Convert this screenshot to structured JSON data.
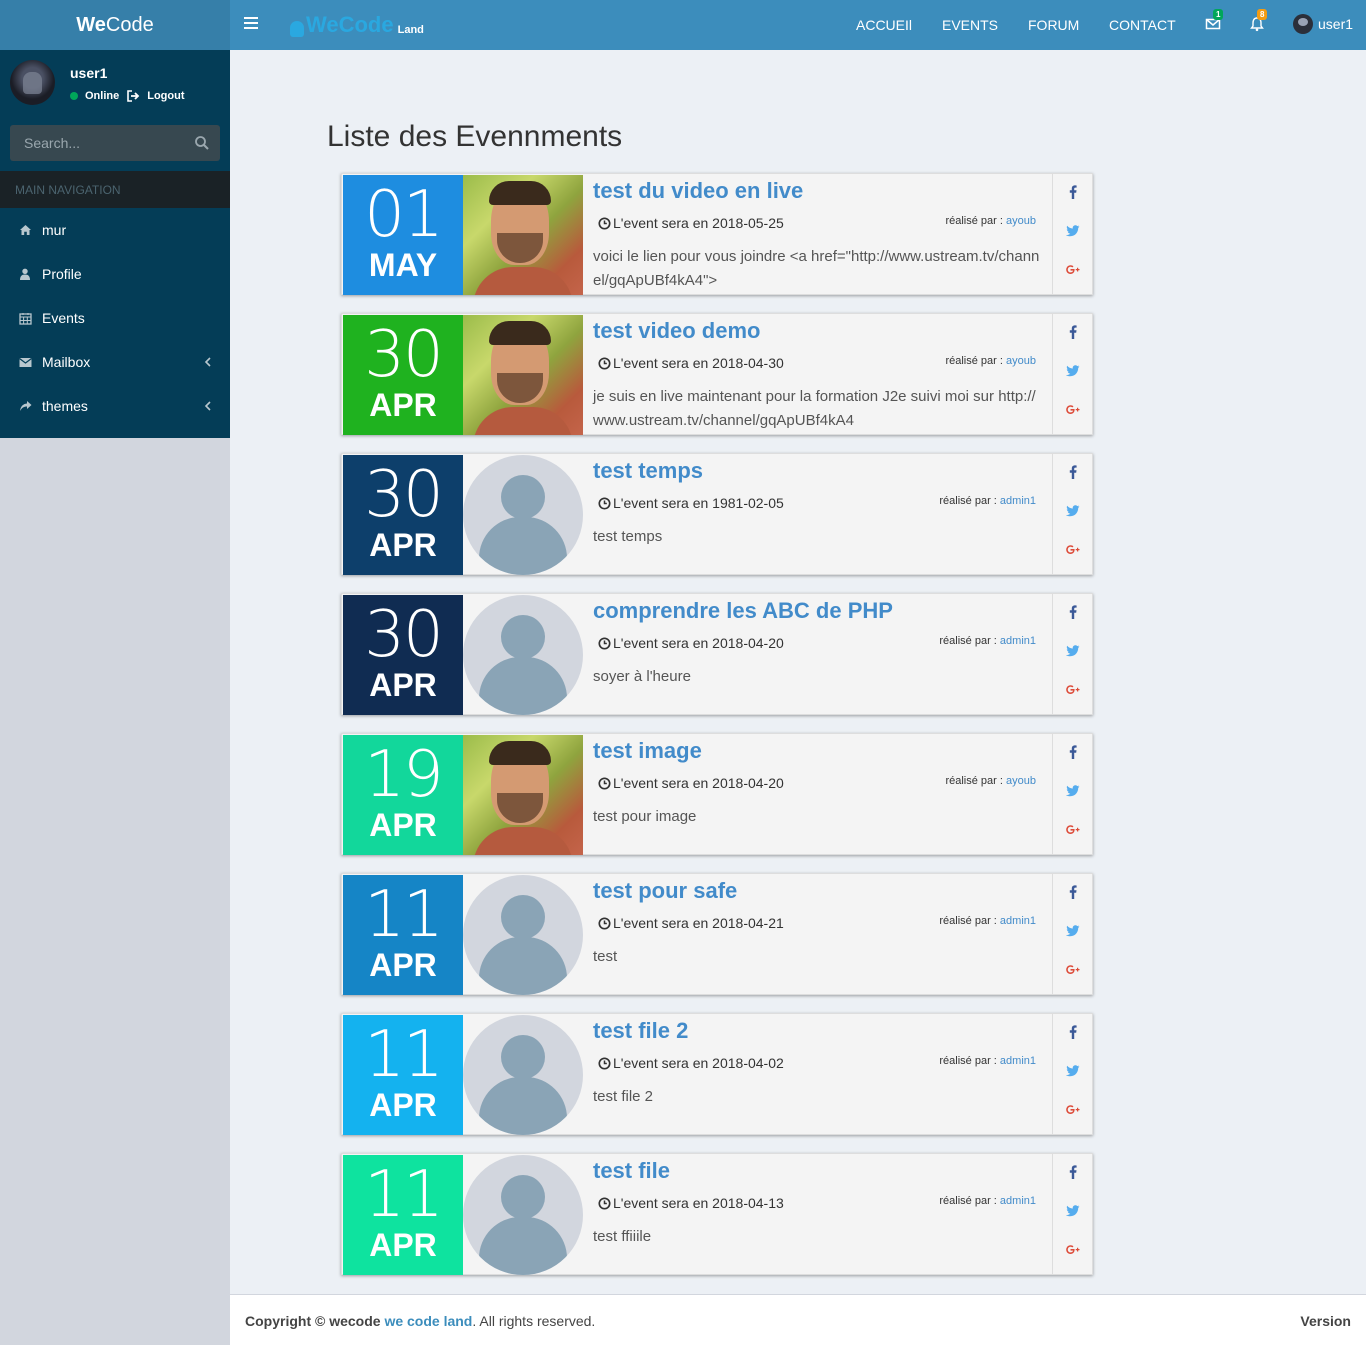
{
  "app": {
    "logo_bold": "We",
    "logo_rest": "Code"
  },
  "header": {
    "brand_name": "WeCode",
    "brand_sub": "Land",
    "nav": [
      "ACCUEIl",
      "EVENTS",
      "FORUM",
      "CONTACT"
    ],
    "messages_count": "1",
    "notifications_count": "8",
    "user": "user1"
  },
  "sidebar": {
    "user_name": "user1",
    "status": "Online",
    "logout": "Logout",
    "search_placeholder": "Search...",
    "nav_header": "MAIN NAVIGATION",
    "items": [
      {
        "label": "mur",
        "icon": "home-icon"
      },
      {
        "label": "Profile",
        "icon": "user-icon"
      },
      {
        "label": "Events",
        "icon": "calendar-icon"
      },
      {
        "label": "Mailbox",
        "icon": "envelope-icon"
      },
      {
        "label": "themes",
        "icon": "share-icon"
      }
    ]
  },
  "page": {
    "title": "Liste des Evennments"
  },
  "events": [
    {
      "day": "01",
      "month": "MAY",
      "color": "#1e8de0",
      "photo": "real",
      "title": "test du video en live",
      "date_text": "L'event sera en 2018-05-25",
      "author_label": "réalisé par :",
      "author": "ayoub",
      "description": "voici le lien pour vous joindre <a href=\"http://www.ustream.tv/channel/gqApUBf4kA4\">"
    },
    {
      "day": "30",
      "month": "APR",
      "color": "#1fb21f",
      "photo": "real",
      "title": "test video demo",
      "date_text": "L'event sera en 2018-04-30",
      "author_label": "réalisé par :",
      "author": "ayoub",
      "description": "je suis en live maintenant pour la formation J2e suivi moi sur http://www.ustream.tv/channel/gqApUBf4kA4"
    },
    {
      "day": "30",
      "month": "APR",
      "color": "#0d3f6b",
      "photo": "default",
      "title": "test temps",
      "date_text": "L'event sera en 1981-02-05",
      "author_label": "réalisé par :",
      "author": "admin1",
      "description": "test temps"
    },
    {
      "day": "30",
      "month": "APR",
      "color": "#102c52",
      "photo": "default",
      "title": "comprendre les ABC de PHP",
      "date_text": "L'event sera en 2018-04-20",
      "author_label": "réalisé par :",
      "author": "admin1",
      "description": "soyer à l'heure"
    },
    {
      "day": "19",
      "month": "APR",
      "color": "#12d79b",
      "photo": "real",
      "title": "test image",
      "date_text": "L'event sera en 2018-04-20",
      "author_label": "réalisé par :",
      "author": "ayoub",
      "description": "test pour image"
    },
    {
      "day": "11",
      "month": "APR",
      "color": "#1585c6",
      "photo": "default",
      "title": "test pour safe",
      "date_text": "L'event sera en 2018-04-21",
      "author_label": "réalisé par :",
      "author": "admin1",
      "description": "test"
    },
    {
      "day": "11",
      "month": "APR",
      "color": "#14b2ef",
      "photo": "default",
      "title": "test file 2",
      "date_text": "L'event sera en 2018-04-02",
      "author_label": "réalisé par :",
      "author": "admin1",
      "description": "test file 2"
    },
    {
      "day": "11",
      "month": "APR",
      "color": "#0ee39f",
      "photo": "default",
      "title": "test file",
      "date_text": "L'event sera en 2018-04-13",
      "author_label": "réalisé par :",
      "author": "admin1",
      "description": "test ffiiile"
    }
  ],
  "footer": {
    "copyright": "Copyright © wecode",
    "link": "we code land",
    "rights": ". All rights reserved.",
    "version_label": "Version"
  }
}
